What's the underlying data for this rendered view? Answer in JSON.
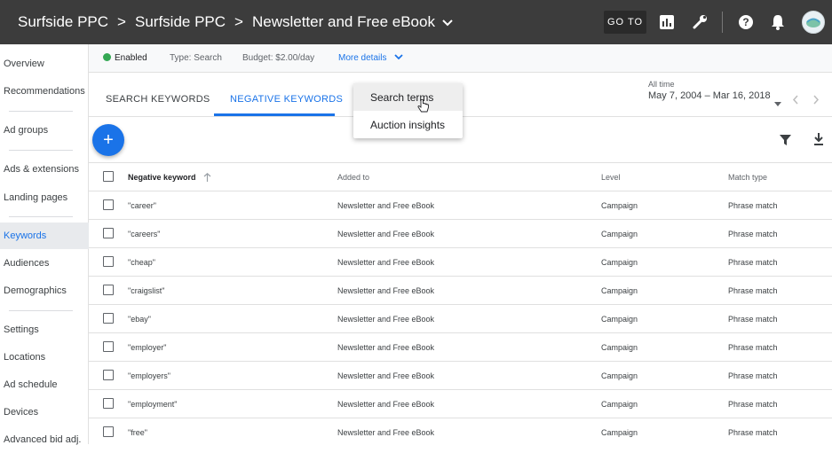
{
  "breadcrumb": {
    "items": [
      "Surfside PPC",
      "Surfside PPC",
      "Newsletter and Free eBook"
    ],
    "separator": ">"
  },
  "topbar": {
    "goto_label": "GO TO",
    "icons": [
      "reports-icon",
      "tools-icon",
      "help-icon",
      "notifications-icon",
      "account-avatar"
    ]
  },
  "sidebar": {
    "items": [
      {
        "label": "Overview"
      },
      {
        "label": "Recommendations"
      },
      {
        "label": "Ad groups"
      },
      {
        "label": "Ads & extensions"
      },
      {
        "label": "Landing pages"
      },
      {
        "label": "Keywords",
        "active": true
      },
      {
        "label": "Audiences"
      },
      {
        "label": "Demographics"
      },
      {
        "label": "Settings"
      },
      {
        "label": "Locations"
      },
      {
        "label": "Ad schedule"
      },
      {
        "label": "Devices"
      },
      {
        "label": "Advanced bid adj."
      }
    ]
  },
  "status": {
    "state": "Enabled",
    "type": "Type: Search",
    "budget": "Budget: $2.00/day",
    "more": "More details"
  },
  "tabs": {
    "search": "SEARCH KEYWORDS",
    "negative": "NEGATIVE KEYWORDS"
  },
  "date": {
    "label": "All time",
    "range": "May 7, 2004 – Mar 16, 2018"
  },
  "dropdown": {
    "items": [
      "Search terms",
      "Auction insights"
    ]
  },
  "table": {
    "headers": [
      "Negative keyword",
      "Added to",
      "Level",
      "Match type"
    ],
    "rows": [
      [
        "\"career\"",
        "Newsletter and Free eBook",
        "Campaign",
        "Phrase match"
      ],
      [
        "\"careers\"",
        "Newsletter and Free eBook",
        "Campaign",
        "Phrase match"
      ],
      [
        "\"cheap\"",
        "Newsletter and Free eBook",
        "Campaign",
        "Phrase match"
      ],
      [
        "\"craigslist\"",
        "Newsletter and Free eBook",
        "Campaign",
        "Phrase match"
      ],
      [
        "\"ebay\"",
        "Newsletter and Free eBook",
        "Campaign",
        "Phrase match"
      ],
      [
        "\"employer\"",
        "Newsletter and Free eBook",
        "Campaign",
        "Phrase match"
      ],
      [
        "\"employers\"",
        "Newsletter and Free eBook",
        "Campaign",
        "Phrase match"
      ],
      [
        "\"employment\"",
        "Newsletter and Free eBook",
        "Campaign",
        "Phrase match"
      ],
      [
        "\"free\"",
        "Newsletter and Free eBook",
        "Campaign",
        "Phrase match"
      ]
    ]
  },
  "colors": {
    "topbar": "#3c3c3c",
    "accent": "#1a73e8",
    "enabled": "#34a853"
  }
}
